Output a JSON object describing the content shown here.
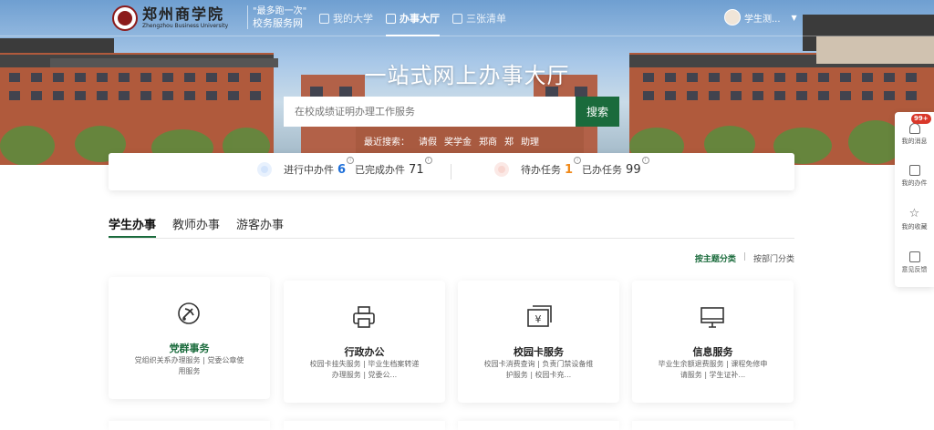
{
  "header": {
    "logo_cn": "郑州商学院",
    "logo_en": "Zhengzhou Business University",
    "slogan_line1": "\"最多跑一次\"",
    "slogan_line2": "校务服务网",
    "nav": [
      {
        "label": "我的大学",
        "icon": "university-icon"
      },
      {
        "label": "办事大厅",
        "icon": "service-hall-icon",
        "active": true
      },
      {
        "label": "三张清单",
        "icon": "list-icon"
      }
    ],
    "user_name": "学生测..."
  },
  "hero": {
    "title": "一站式网上办事大厅",
    "search_placeholder": "在校成绩证明办理工作服务",
    "search_button": "搜索",
    "recent_label": "最近搜索：",
    "recent_items": [
      "请假",
      "奖学金",
      "郑商",
      "郑",
      "助理"
    ]
  },
  "stats": {
    "in_progress_label": "进行中办件",
    "in_progress_value": "6",
    "completed_label": "已完成办件",
    "completed_value": "71",
    "pending_label": "待办任务",
    "pending_value": "1",
    "done_label": "已办任务",
    "done_value": "99",
    "info_mark": "i"
  },
  "tabs": [
    "学生办事",
    "教师办事",
    "游客办事"
  ],
  "filter": {
    "by_topic": "按主题分类",
    "separator": "|",
    "by_dept": "按部门分类"
  },
  "cards": [
    {
      "title": "党群事务",
      "desc": "党组织关系办理服务 | 党委公章使用服务",
      "icon": "party-emblem-icon"
    },
    {
      "title": "行政办公",
      "desc": "校园卡挂失服务 | 毕业生档案转递办理服务 | 党委公...",
      "icon": "printer-icon"
    },
    {
      "title": "校园卡服务",
      "desc": "校园卡消费查询 | 负责门禁设备维护服务 | 校园卡充...",
      "icon": "yuan-card-icon"
    },
    {
      "title": "信息服务",
      "desc": "毕业生余额退费服务 | 课程免修申请服务 | 学生证补...",
      "icon": "monitor-icon"
    }
  ],
  "side": {
    "badge": "99+",
    "items": [
      {
        "label": "我的消息",
        "icon": "bell-icon"
      },
      {
        "label": "我的办件",
        "icon": "document-icon"
      },
      {
        "label": "我的收藏",
        "icon": "star-icon"
      },
      {
        "label": "意见反馈",
        "icon": "feedback-icon"
      }
    ]
  },
  "colors": {
    "primary": "#1a6b3c",
    "blue": "#1e6fd9",
    "orange": "#f0891a",
    "badge": "#d9382a"
  }
}
